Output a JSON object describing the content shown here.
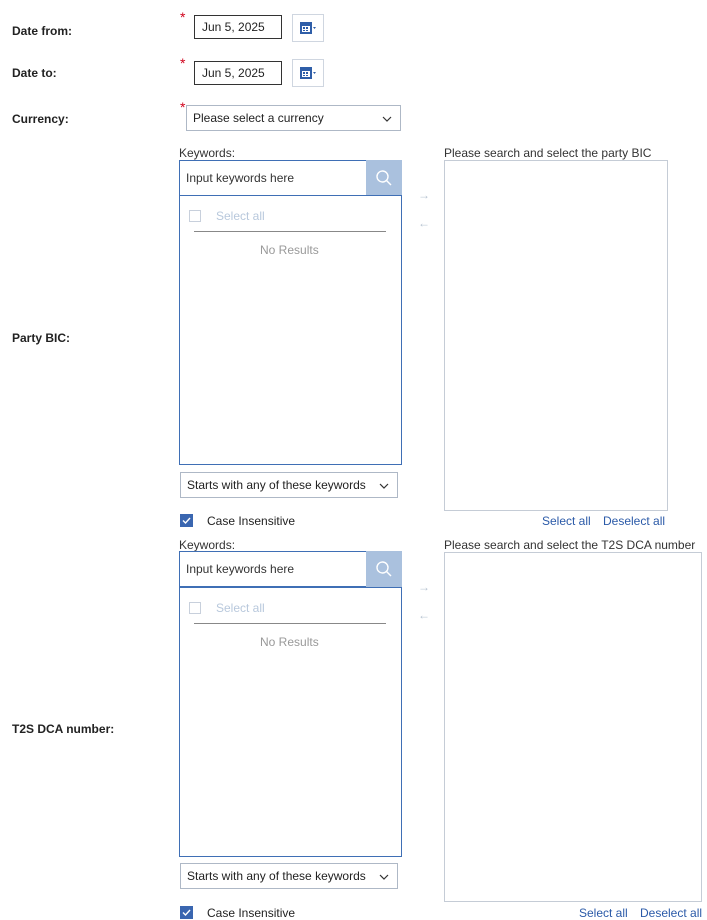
{
  "form": {
    "date_from": {
      "label": "Date from:",
      "value": "Jun 5, 2025",
      "required_mark": "*"
    },
    "date_to": {
      "label": "Date to:",
      "value": "Jun 5, 2025",
      "required_mark": "*"
    },
    "currency": {
      "label": "Currency:",
      "placeholder": "Please select a currency",
      "required_mark": "*"
    }
  },
  "party_bic": {
    "label": "Party BIC:",
    "keywords_label": "Keywords:",
    "search_placeholder": "Input keywords here",
    "select_all": "Select all",
    "no_results": "No Results",
    "match_mode": "Starts with any of these keywords",
    "case_insensitive": "Case Insensitive",
    "right_header": "Please search and select the party BIC",
    "link_select_all": "Select all",
    "link_deselect_all": "Deselect all",
    "arrow_right": "→",
    "arrow_left": "←"
  },
  "t2s_dca": {
    "label": "T2S DCA number:",
    "keywords_label": "Keywords:",
    "search_placeholder": "Input keywords here",
    "select_all": "Select all",
    "no_results": "No Results",
    "match_mode": "Starts with any of these keywords",
    "case_insensitive": "Case Insensitive",
    "right_header": "Please search and select the T2S DCA number",
    "link_select_all": "Select all",
    "link_deselect_all": "Deselect all",
    "arrow_right": "→",
    "arrow_left": "←"
  },
  "colors": {
    "accent": "#3f6fb5",
    "required": "#d0021b",
    "link": "#2b5aa8",
    "search_button": "#aac1de"
  }
}
